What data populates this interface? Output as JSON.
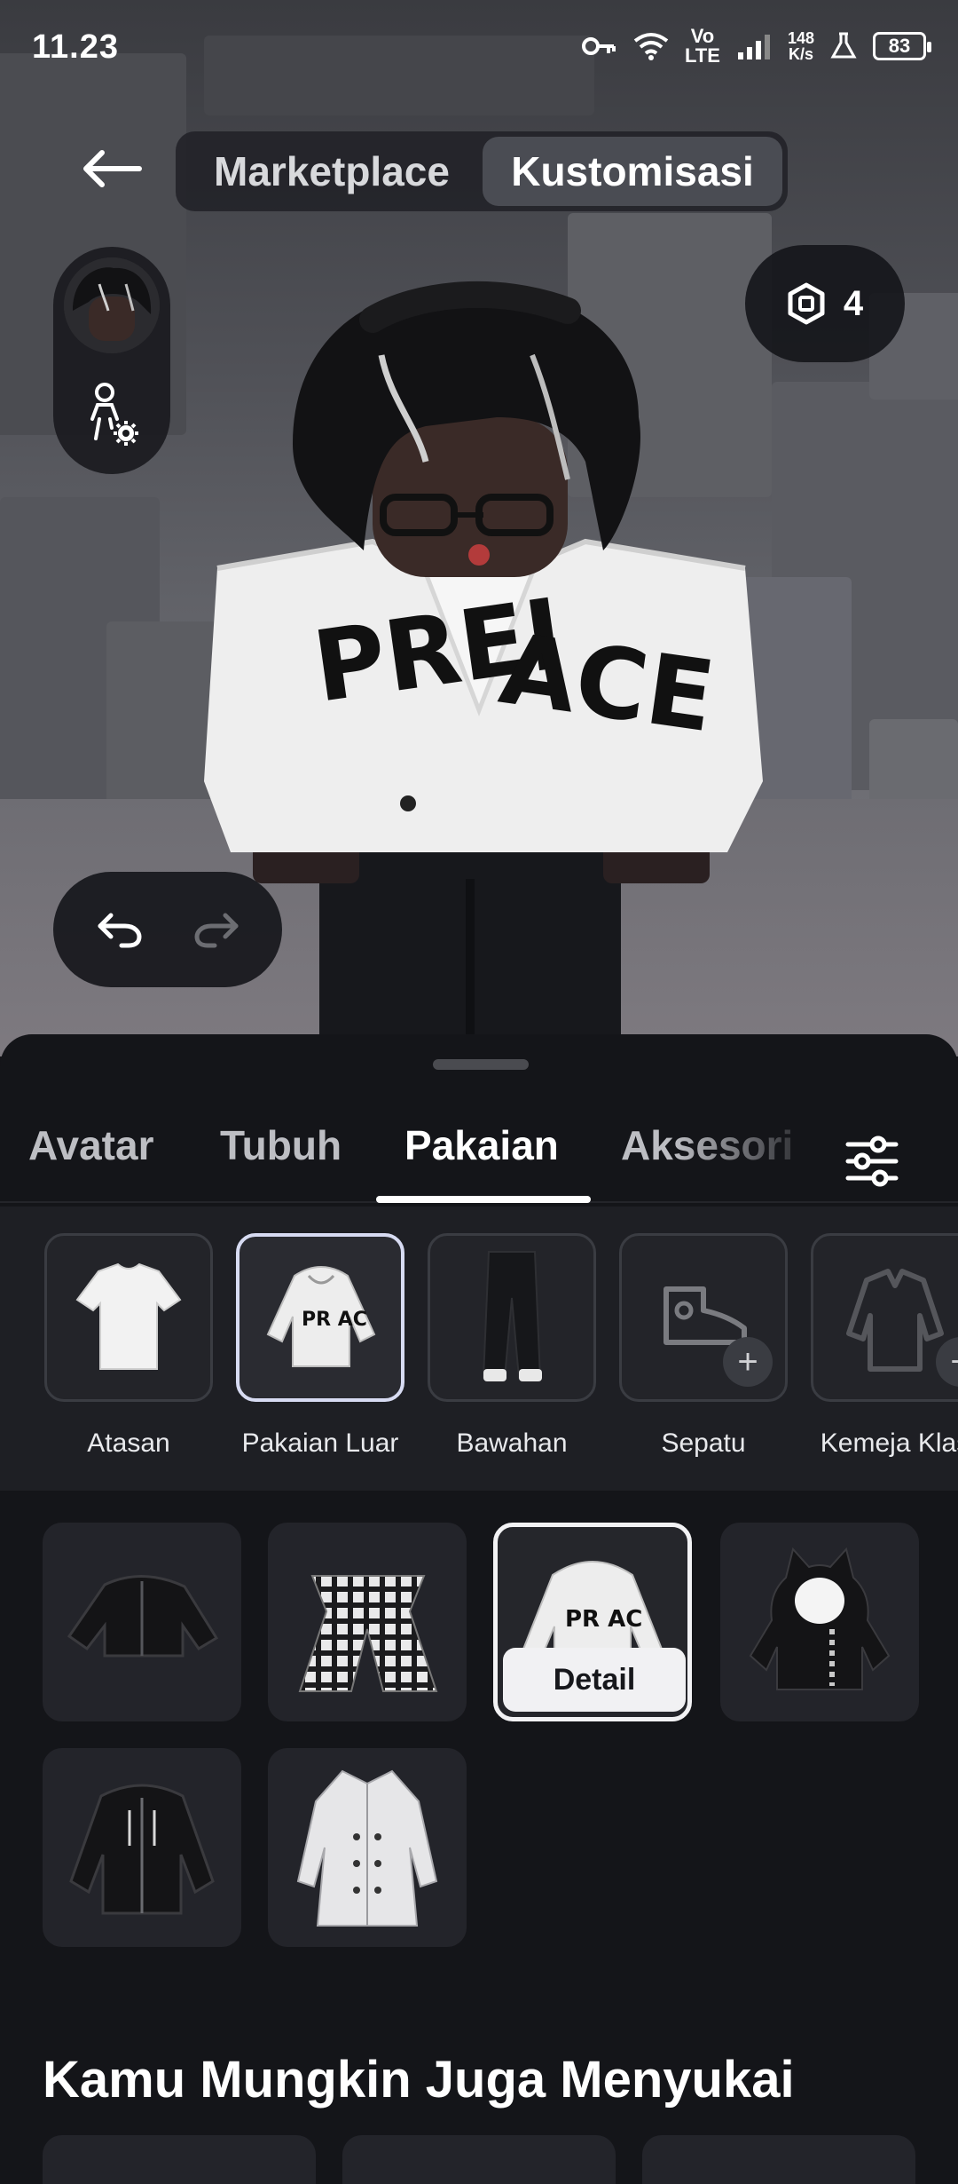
{
  "status_bar": {
    "time": "11.23",
    "network_label": "Vo LTE",
    "speed_value": "148",
    "speed_unit": "K/s",
    "battery": "83",
    "icons": [
      "key-icon",
      "wifi-icon",
      "signal-icon",
      "lab-flask-icon",
      "battery-icon"
    ]
  },
  "header": {
    "back_icon": "arrow-left-icon",
    "tabs": [
      {
        "label": "Marketplace",
        "active": false
      },
      {
        "label": "Kustomisasi",
        "active": true
      }
    ]
  },
  "robux": {
    "icon": "robux-icon",
    "amount": "4"
  },
  "side_tools": {
    "avatar_thumbnail": "avatar-thumbnail",
    "settings_icon": "avatar-settings-icon"
  },
  "history": {
    "undo_icon": "undo-icon",
    "redo_icon": "redo-icon",
    "redo_enabled": false
  },
  "category_tabs": [
    {
      "label": "Avatar",
      "active": false
    },
    {
      "label": "Tubuh",
      "active": false
    },
    {
      "label": "Pakaian",
      "active": true
    },
    {
      "label": "Aksesori",
      "active": false
    }
  ],
  "filter_icon": "sliders-icon",
  "subcategories": [
    {
      "label": "Atasan",
      "selected": false,
      "icon": "tshirt-icon"
    },
    {
      "label": "Pakaian Luar",
      "selected": true,
      "icon": "hoodie-icon"
    },
    {
      "label": "Bawahan",
      "selected": false,
      "icon": "pants-icon"
    },
    {
      "label": "Sepatu",
      "selected": false,
      "icon": "shoe-icon",
      "add": true
    },
    {
      "label": "Kemeja Klas",
      "selected": false,
      "icon": "classic-shirt-icon",
      "add": true
    }
  ],
  "items": [
    {
      "name": "black-cropped-jacket",
      "selected": false
    },
    {
      "name": "plaid-waist-shirt",
      "selected": false
    },
    {
      "name": "white-graphic-hoodie",
      "selected": true
    },
    {
      "name": "black-cat-hoodie",
      "selected": false
    },
    {
      "name": "black-zip-hoodie",
      "selected": false
    },
    {
      "name": "white-long-coat",
      "selected": false
    }
  ],
  "detail_button": "Detail",
  "recommend_title": "Kamu Mungkin Juga Menyukai"
}
